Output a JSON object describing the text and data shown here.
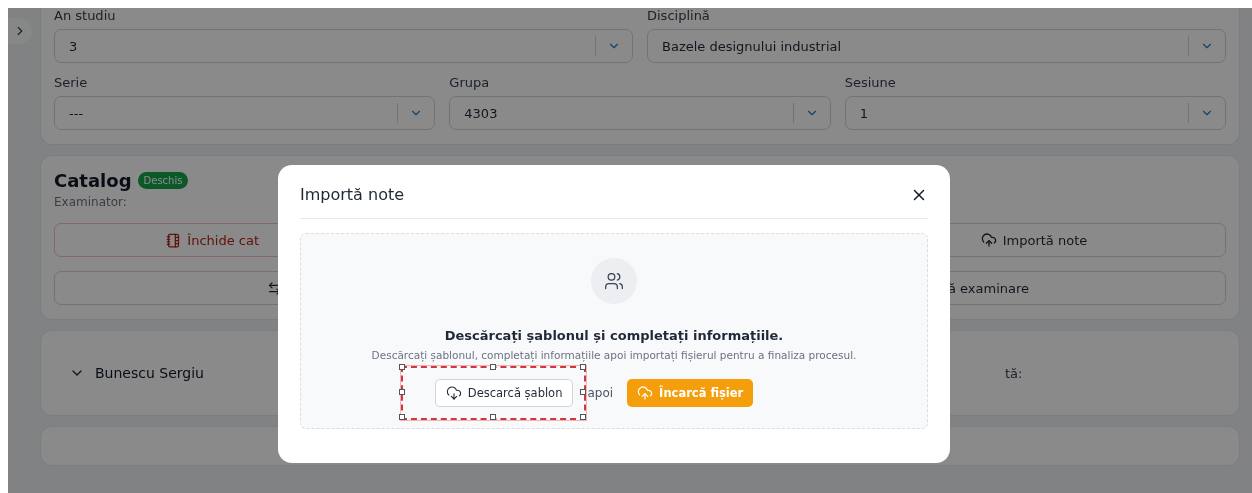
{
  "filter_rows": [
    [
      {
        "label": "An studiu",
        "value": "3"
      },
      {
        "label": "Disciplină",
        "value": "Bazele designului industrial"
      }
    ],
    [
      {
        "label": "Serie",
        "value": "---"
      },
      {
        "label": "Grupa",
        "value": "4303"
      },
      {
        "label": "Sesiune",
        "value": "1"
      }
    ]
  ],
  "catalog": {
    "title": "Catalog",
    "status": "Deschis",
    "examiner_label": "Examinator:",
    "close_action": {
      "label": "Închide cat"
    },
    "import_action": {
      "label": "Importă note"
    },
    "exam_action": {
      "label": "ă examinare"
    }
  },
  "student": {
    "name": "Bunescu Sergiu",
    "aside": "tă:"
  },
  "modal": {
    "title": "Importă note",
    "heading": "Descărcați șablonul și completați informațiile.",
    "description": "Descărcați șablonul, completați informațiile apoi importați fișierul pentru a finaliza procesul.",
    "download_button": "Descarcă șablon",
    "separator": "apoi",
    "upload_button": "Încarcă fișier"
  }
}
